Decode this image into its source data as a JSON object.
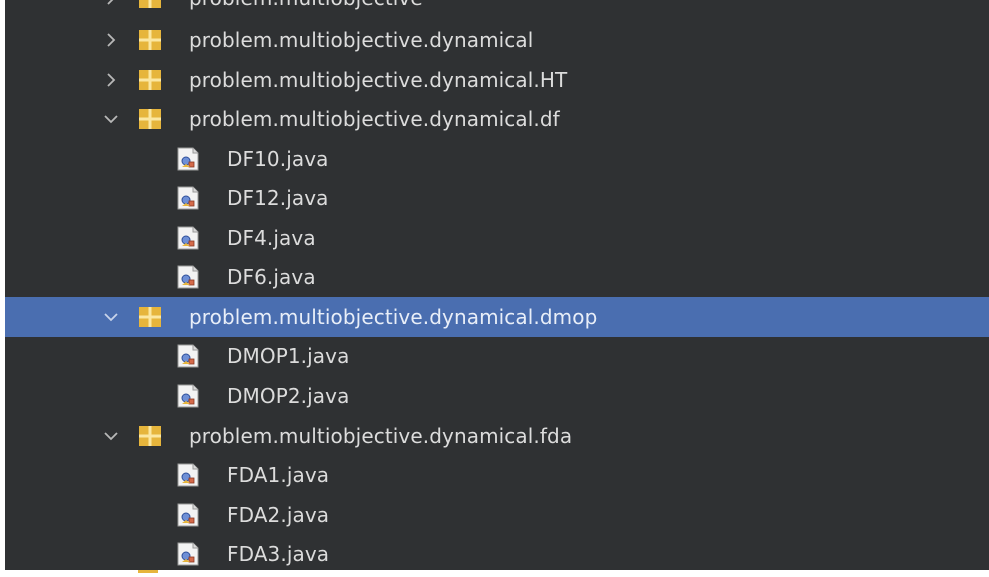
{
  "tree": {
    "partial_top_label": "problem.multiobjective",
    "rows": [
      {
        "type": "package",
        "label": "problem.multiobjective.dynamical",
        "expanded": false,
        "selected": false
      },
      {
        "type": "package",
        "label": "problem.multiobjective.dynamical.HT",
        "expanded": false,
        "selected": false
      },
      {
        "type": "package",
        "label": "problem.multiobjective.dynamical.df",
        "expanded": true,
        "selected": false
      },
      {
        "type": "file",
        "label": "DF10.java"
      },
      {
        "type": "file",
        "label": "DF12.java"
      },
      {
        "type": "file",
        "label": "DF4.java"
      },
      {
        "type": "file",
        "label": "DF6.java"
      },
      {
        "type": "package",
        "label": "problem.multiobjective.dynamical.dmop",
        "expanded": true,
        "selected": true
      },
      {
        "type": "file",
        "label": "DMOP1.java"
      },
      {
        "type": "file",
        "label": "DMOP2.java"
      },
      {
        "type": "package",
        "label": "problem.multiobjective.dynamical.fda",
        "expanded": true,
        "selected": false
      },
      {
        "type": "file",
        "label": "FDA1.java"
      },
      {
        "type": "file",
        "label": "FDA2.java"
      },
      {
        "type": "file",
        "label": "FDA3.java"
      }
    ]
  },
  "colors": {
    "background": "#2f3133",
    "selection": "#4a6eb0",
    "text": "#dcdcdc",
    "package_icon": "#e6b53c"
  },
  "icons": {
    "collapsed": "chevron-right-icon",
    "expanded": "chevron-down-icon",
    "package": "package-icon",
    "file": "java-file-icon"
  }
}
